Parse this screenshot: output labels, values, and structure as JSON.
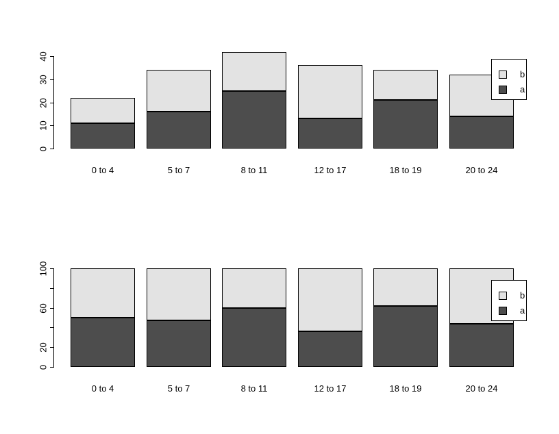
{
  "chart_data": [
    {
      "type": "bar",
      "id": "stacked-counts",
      "title": "",
      "xlabel": "",
      "ylabel": "",
      "categories": [
        "0 to 4",
        "5 to 7",
        "8 to 11",
        "12 to 17",
        "18 to 19",
        "20 to 24"
      ],
      "series": [
        {
          "name": "a",
          "color": "#4d4d4d",
          "values": [
            11,
            16,
            25,
            13,
            21,
            14
          ]
        },
        {
          "name": "b",
          "color": "#e3e3e3",
          "values": [
            11,
            18,
            17,
            23,
            13,
            18
          ]
        }
      ],
      "totals": [
        22,
        34,
        42,
        36,
        34,
        32
      ],
      "stacked": true,
      "ylim": [
        0,
        40
      ],
      "yticks": [
        0,
        10,
        20,
        30,
        40
      ],
      "ytick_labels": [
        "0",
        "10",
        "20",
        "30",
        "40"
      ],
      "grid": false,
      "legend": {
        "position": "top-right",
        "entries": [
          "b",
          "a"
        ]
      }
    },
    {
      "type": "bar",
      "id": "stacked-percent",
      "title": "",
      "xlabel": "",
      "ylabel": "",
      "categories": [
        "0 to 4",
        "5 to 7",
        "8 to 11",
        "12 to 17",
        "18 to 19",
        "20 to 24"
      ],
      "series": [
        {
          "name": "a",
          "color": "#4d4d4d",
          "values": [
            50,
            47,
            60,
            36,
            62,
            44
          ]
        },
        {
          "name": "b",
          "color": "#e3e3e3",
          "values": [
            50,
            53,
            40,
            64,
            38,
            56
          ]
        }
      ],
      "totals": [
        100,
        100,
        100,
        100,
        100,
        100
      ],
      "stacked": true,
      "ylim": [
        0,
        100
      ],
      "yticks": [
        0,
        20,
        40,
        60,
        80,
        100
      ],
      "ytick_labels": [
        "0",
        "20",
        "",
        "60",
        "",
        "100"
      ],
      "grid": false,
      "legend": {
        "position": "top-right",
        "entries": [
          "b",
          "a"
        ]
      }
    }
  ],
  "legend": {
    "entries": [
      {
        "label": "b",
        "color": "#e3e3e3"
      },
      {
        "label": "a",
        "color": "#4d4d4d"
      }
    ]
  },
  "colors": {
    "series_a": "#4d4d4d",
    "series_b": "#e3e3e3",
    "axis": "#000000",
    "background": "#ffffff"
  }
}
